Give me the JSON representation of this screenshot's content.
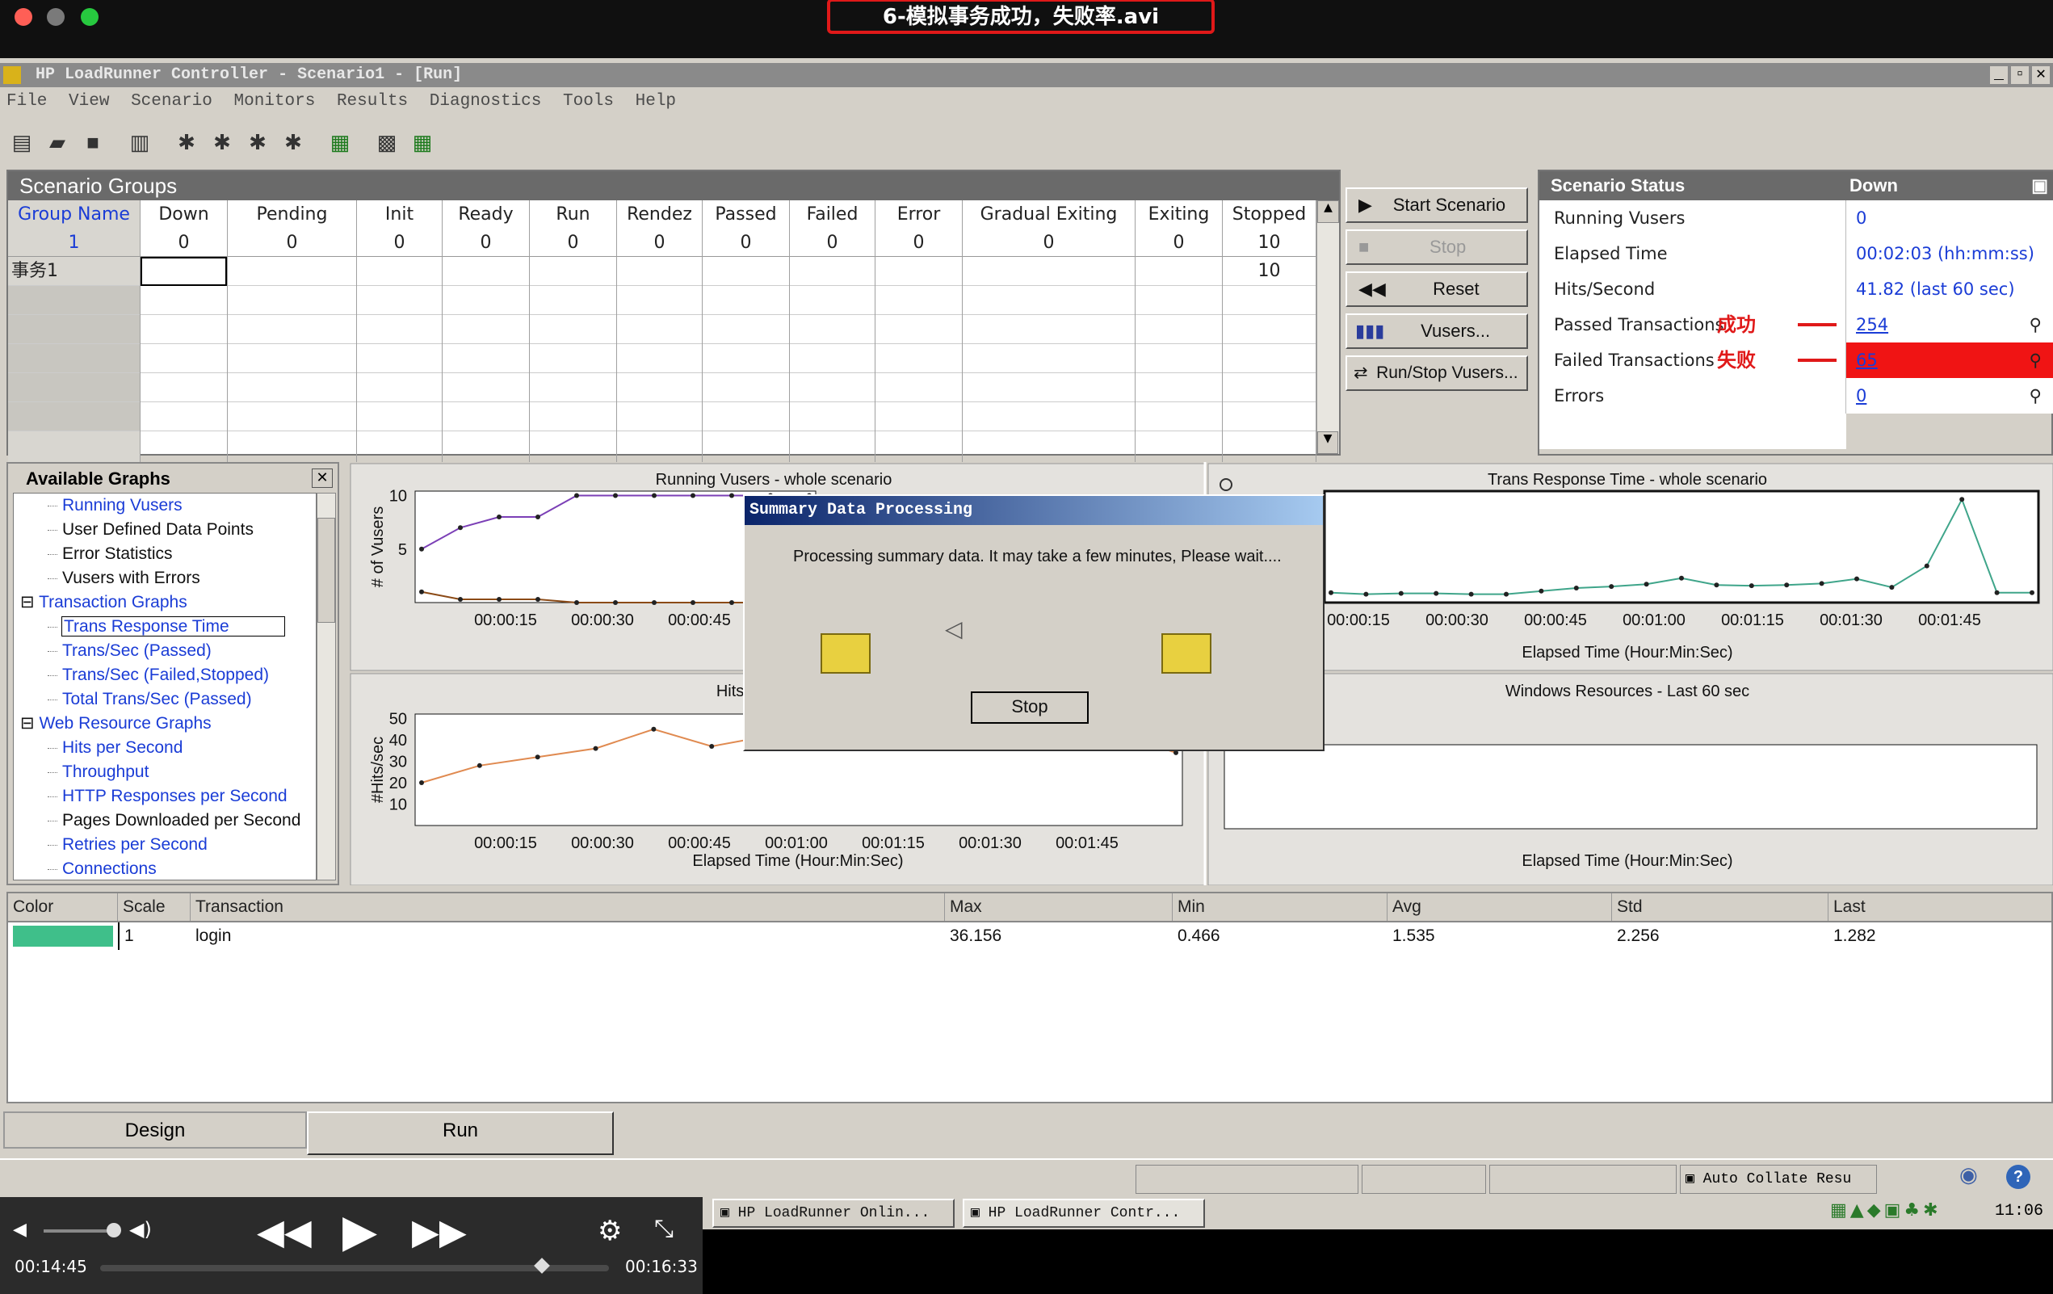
{
  "mac": {
    "title": "6-模拟事务成功，失败率.avi"
  },
  "window": {
    "title": "HP LoadRunner Controller - Scenario1 - [Run]",
    "controls": [
      "_",
      "▫",
      "✕"
    ]
  },
  "menu": [
    "File",
    "View",
    "Scenario",
    "Monitors",
    "Results",
    "Diagnostics",
    "Tools",
    "Help"
  ],
  "groups": {
    "title": "Scenario Groups",
    "columns": [
      "Group Name",
      "Down",
      "Pending",
      "Init",
      "Ready",
      "Run",
      "Rendez",
      "Passed",
      "Failed",
      "Error",
      "Gradual Exiting",
      "Exiting",
      "Stopped"
    ],
    "totals": [
      "1",
      "0",
      "0",
      "0",
      "0",
      "0",
      "0",
      "0",
      "0",
      "0",
      "0",
      "0",
      "10"
    ],
    "rows": [
      {
        "name": "事务1",
        "stopped": "10"
      }
    ]
  },
  "buttons": {
    "start": "Start Scenario",
    "stop": "Stop",
    "reset": "Reset",
    "vusers": "Vusers...",
    "runstop": "Run/Stop Vusers..."
  },
  "status": {
    "title": "Scenario Status",
    "state": "Down",
    "rows": [
      {
        "label": "Running Vusers",
        "value": "0"
      },
      {
        "label": "Elapsed Time",
        "value": "00:02:03 (hh:mm:ss)"
      },
      {
        "label": "Hits/Second",
        "value": "41.82 (last 60 sec)"
      },
      {
        "label": "Passed Transactions",
        "value": "254",
        "note": "成功"
      },
      {
        "label": "Failed Transactions",
        "value": "65",
        "note": "失败"
      },
      {
        "label": "Errors",
        "value": "0"
      }
    ]
  },
  "graphs": {
    "title": "Available Graphs",
    "items": [
      {
        "label": "Running Vusers",
        "blue": true,
        "indent": 1
      },
      {
        "label": "User Defined Data Points",
        "indent": 1
      },
      {
        "label": "Error Statistics",
        "indent": 1
      },
      {
        "label": "Vusers with Errors",
        "indent": 1
      },
      {
        "label": "Transaction Graphs",
        "blue": true,
        "indent": 0,
        "folder": "⊟"
      },
      {
        "label": "Trans Response Time",
        "blue": true,
        "indent": 1,
        "selected": true
      },
      {
        "label": "Trans/Sec (Passed)",
        "blue": true,
        "indent": 1
      },
      {
        "label": "Trans/Sec (Failed,Stopped)",
        "blue": true,
        "indent": 1
      },
      {
        "label": "Total Trans/Sec (Passed)",
        "blue": true,
        "indent": 1
      },
      {
        "label": "Web Resource Graphs",
        "blue": true,
        "indent": 0,
        "folder": "⊟"
      },
      {
        "label": "Hits per Second",
        "blue": true,
        "indent": 1
      },
      {
        "label": "Throughput",
        "blue": true,
        "indent": 1
      },
      {
        "label": "HTTP Responses per Second",
        "blue": true,
        "indent": 1
      },
      {
        "label": "Pages Downloaded per Second",
        "indent": 1
      },
      {
        "label": "Retries per Second",
        "blue": true,
        "indent": 1
      },
      {
        "label": "Connections",
        "blue": true,
        "indent": 1
      }
    ]
  },
  "chart_data": [
    {
      "type": "line",
      "title": "Running Vusers - whole scenario",
      "ylabel": "# of Vusers",
      "yticks": [
        "10",
        "5"
      ],
      "xticks": [
        "00:00:15",
        "00:00:30",
        "00:00:45"
      ],
      "series": [
        {
          "color": "#7b3fb6",
          "values": [
            5,
            7,
            8,
            8,
            10,
            10,
            10,
            10,
            10,
            10,
            10
          ]
        },
        {
          "color": "#8b4a16",
          "values": [
            1,
            0.3,
            0.3,
            0.3,
            0,
            0,
            0,
            0,
            0,
            0,
            0
          ]
        }
      ],
      "ymax": 10
    },
    {
      "type": "line",
      "title": "Hits per Second",
      "ylabel": "#Hits/sec",
      "yticks": [
        "50",
        "40",
        "30",
        "20",
        "10"
      ],
      "xticks": [
        "00:00:15",
        "00:00:30",
        "00:00:45",
        "00:01:00",
        "00:01:15",
        "00:01:30",
        "00:01:45"
      ],
      "xlabel": "Elapsed Time (Hour:Min:Sec)",
      "series": [
        {
          "color": "#e08a50",
          "values": [
            20,
            28,
            32,
            36,
            45,
            37,
            42,
            47,
            50,
            48,
            49,
            45,
            43,
            34
          ]
        }
      ],
      "ymax": 50
    },
    {
      "type": "line",
      "title": "Trans Response Time - whole scenario",
      "xticks": [
        "00:00:15",
        "00:00:30",
        "00:00:45",
        "00:01:00",
        "00:01:15",
        "00:01:30",
        "00:01:45"
      ],
      "xlabel": "Elapsed Time (Hour:Min:Sec)",
      "series": [
        {
          "color": "#3fa58a",
          "values": [
            1.3,
            1.1,
            1.2,
            1.2,
            1.1,
            1.1,
            1.5,
            1.9,
            2.1,
            2.4,
            3.2,
            2.3,
            2.2,
            2.3,
            2.5,
            3.1,
            2.0,
            4.8,
            13.5,
            1.3,
            1.3
          ]
        }
      ],
      "ymax": 14
    },
    {
      "type": "line",
      "title": "Windows Resources - Last 60 sec",
      "xlabel": "Elapsed Time (Hour:Min:Sec)",
      "series": []
    }
  ],
  "dialog": {
    "title": "Summary Data Processing",
    "message": "Processing summary data. It may take a few minutes, Please wait....",
    "button": "Stop"
  },
  "legend": {
    "columns": [
      "Color",
      "Scale",
      "Transaction",
      "Max",
      "Min",
      "Avg",
      "Std",
      "Last"
    ],
    "rows": [
      {
        "color": "#3fbf8a",
        "scale": "1",
        "transaction": "login",
        "max": "36.156",
        "min": "0.466",
        "avg": "1.535",
        "std": "2.256",
        "last": "1.282"
      }
    ]
  },
  "tabs": [
    "Design",
    "Run"
  ],
  "statusbar": {
    "auto": "Auto Collate Resu"
  },
  "taskbar": {
    "items": [
      "HP LoadRunner Onlin...",
      "HP LoadRunner Contr..."
    ],
    "clock": "11:06"
  },
  "player": {
    "current": "00:14:45",
    "total": "00:16:33"
  }
}
